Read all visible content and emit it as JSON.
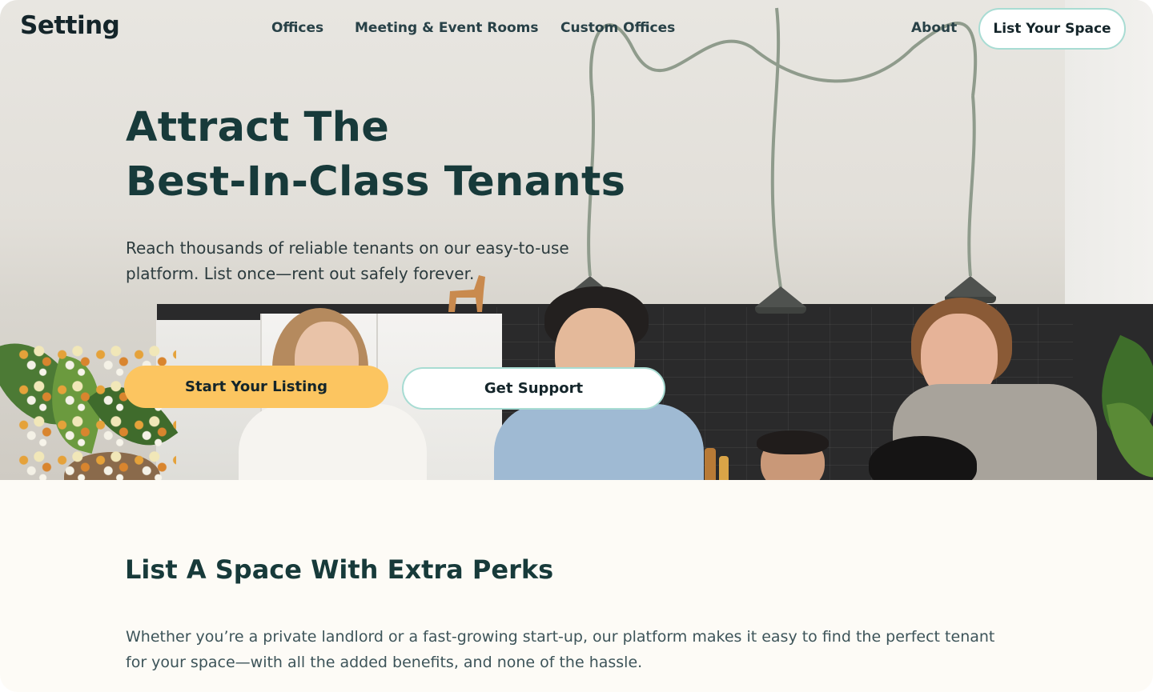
{
  "brand": {
    "logo_text": "Setting"
  },
  "nav": {
    "links": [
      "Offices",
      "Meeting & Event Rooms",
      "Custom Offices",
      "About"
    ],
    "cta_label": "List Your Space"
  },
  "hero": {
    "title_line1": "Attract The",
    "title_line2": "Best-In-Class Tenants",
    "subtitle": "Reach thousands of reliable tenants on our easy-to-use platform. List once—rent out safely forever.",
    "primary_button": "Start Your Listing",
    "secondary_button": "Get Support"
  },
  "perks": {
    "title": "List A Space With Extra Perks",
    "body": "Whether you’re a private landlord or a fast-growing start-up, our platform makes it easy to find the perfect tenant for your space—with all the added benefits, and none of the hassle."
  },
  "colors": {
    "accent_yellow": "#fcc560",
    "accent_mint": "#a8dcd3",
    "heading": "#173a3a",
    "section_background": "#fdfbf6"
  }
}
